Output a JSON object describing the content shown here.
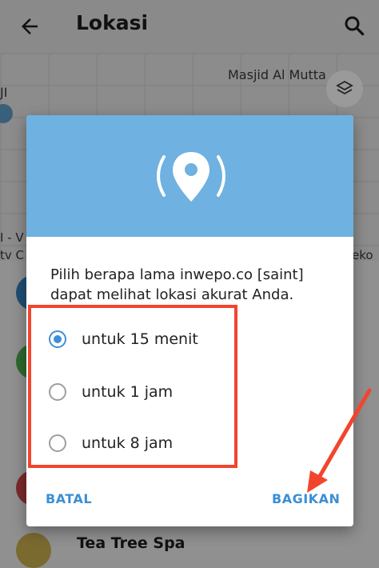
{
  "appbar": {
    "title": "Lokasi"
  },
  "map": {
    "place_label": "Masjid Al Mutta",
    "edge_labels": [
      "JI",
      "I - V",
      "tv C",
      "eko"
    ]
  },
  "dialog": {
    "message": "Pilih berapa lama inwepo.co [saint] dapat melihat lokasi akurat Anda.",
    "options": [
      {
        "label": "untuk 15 menit",
        "selected": true
      },
      {
        "label": "untuk 1 jam",
        "selected": false
      },
      {
        "label": "untuk 8 jam",
        "selected": false
      }
    ],
    "cancel_label": "BATAL",
    "share_label": "BAGIKAN"
  },
  "list": {
    "visible_row_title": "Tea Tree Spa"
  },
  "colors": {
    "accent": "#3a8fd4",
    "dialog_header": "#6fb1e0",
    "annotation": "#f2452d"
  },
  "icons": [
    "back-arrow-icon",
    "search-icon",
    "layers-icon",
    "location-broadcast-icon"
  ]
}
